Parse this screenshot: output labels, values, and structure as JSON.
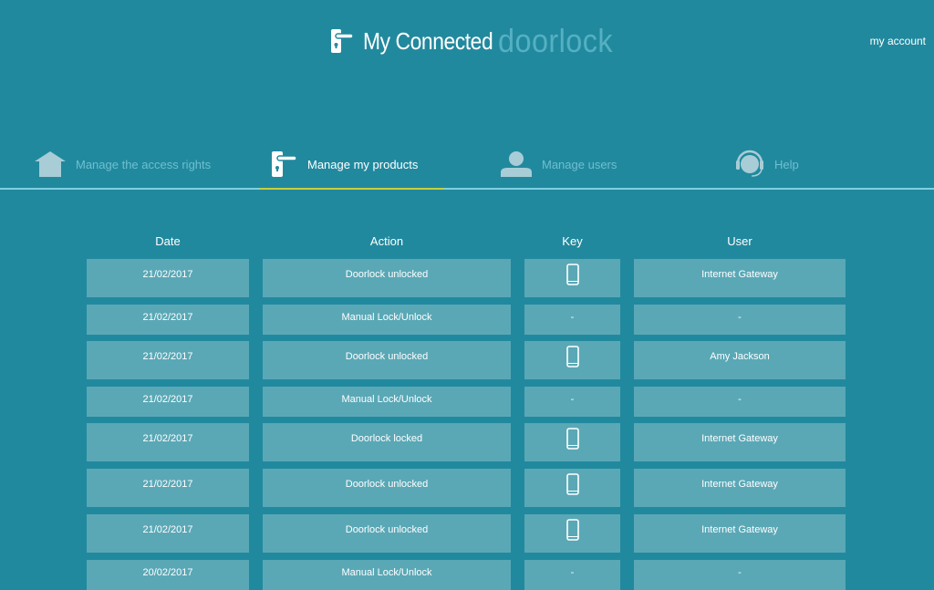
{
  "header": {
    "title_main": "My Connected",
    "title_sub": "doorlock",
    "account_link": "my account"
  },
  "nav": {
    "tabs": [
      {
        "label": "Manage the access rights",
        "icon": "house-icon",
        "active": false
      },
      {
        "label": "Manage my products",
        "icon": "door-handle-icon",
        "active": true
      },
      {
        "label": "Manage users",
        "icon": "user-icon",
        "active": false
      },
      {
        "label": "Help",
        "icon": "headset-icon",
        "active": false
      }
    ]
  },
  "table": {
    "columns": [
      "Date",
      "Action",
      "Key",
      "User"
    ],
    "rows": [
      {
        "date": "21/02/2017",
        "action": "Doorlock unlocked",
        "key": "smartphone-icon",
        "user": "Internet Gateway"
      },
      {
        "date": "21/02/2017",
        "action": "Manual Lock/Unlock",
        "key": "-",
        "user": "-"
      },
      {
        "date": "21/02/2017",
        "action": "Doorlock unlocked",
        "key": "smartphone-icon",
        "user": "Amy Jackson"
      },
      {
        "date": "21/02/2017",
        "action": "Manual Lock/Unlock",
        "key": "-",
        "user": "-"
      },
      {
        "date": "21/02/2017",
        "action": "Doorlock locked",
        "key": "smartphone-icon",
        "user": "Internet Gateway"
      },
      {
        "date": "21/02/2017",
        "action": "Doorlock unlocked",
        "key": "smartphone-icon",
        "user": "Internet Gateway"
      },
      {
        "date": "21/02/2017",
        "action": "Doorlock unlocked",
        "key": "smartphone-icon",
        "user": "Internet Gateway"
      },
      {
        "date": "20/02/2017",
        "action": "Manual Lock/Unlock",
        "key": "-",
        "user": "-"
      }
    ]
  },
  "colors": {
    "background": "#21899e",
    "cell": "#5aa8b6",
    "active_underline": "#c9cf3a",
    "nav_line": "#7ed0e2",
    "inactive_text": "#6fbfd0",
    "inactive_icon": "#a8cdd6"
  }
}
